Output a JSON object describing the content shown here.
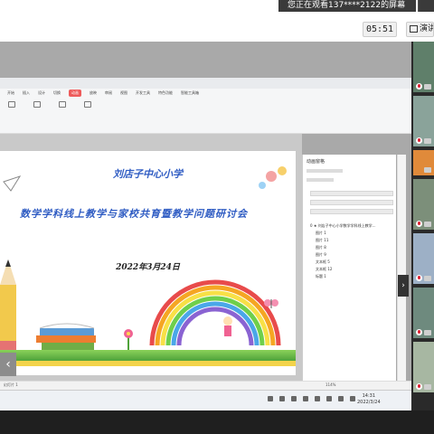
{
  "meeting": {
    "watching_banner": "您正在观看137****2122的屏幕",
    "timer": "05:51",
    "present_label": "演讲"
  },
  "ppt": {
    "menu_tabs": [
      "开始",
      "插入",
      "设计",
      "切换",
      "动画",
      "放映",
      "审阅",
      "视图",
      "开发工具",
      "特色功能",
      "智能工具箱"
    ],
    "active_tab": "动画",
    "status_left": "幻灯片 1",
    "zoom": "114%"
  },
  "slide": {
    "title": "刘店子中心小学",
    "subtitle": "数学学科线上教学与家校共育暨教学问题研讨会",
    "date": "2022年3月24日"
  },
  "pane": {
    "header": "动画窗格",
    "items": [
      "0 ★ 刘店子中心小学数学学科线上教学...",
      "图片 1",
      "图片 11",
      "图片 8",
      "图片 9",
      "文本框 5",
      "文本框 12",
      "标题 1"
    ]
  },
  "taskbar": {
    "time": "14:31",
    "date": "2022/3/24"
  },
  "colors": {
    "accent": "#ee5b5b",
    "title_blue": "#2f5cc3"
  }
}
